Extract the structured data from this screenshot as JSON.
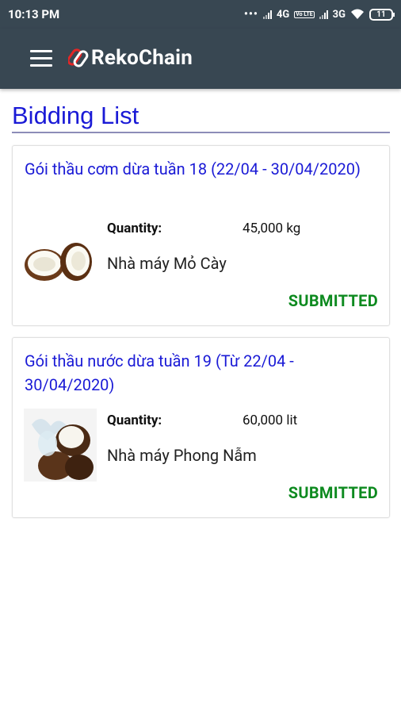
{
  "status_bar": {
    "time": "10:13 PM",
    "net1": "4G",
    "volte": "Vo LTE",
    "net2": "3G",
    "battery": "11"
  },
  "app_bar": {
    "menu_icon": "hamburger-menu-icon",
    "logo_text": "RekoChain"
  },
  "page": {
    "title": "Bidding List"
  },
  "colors": {
    "bar": "#384752",
    "title": "#1a1ad6",
    "status": "#0d8a1f"
  },
  "bids": [
    {
      "title": "Gói thầu cơm dừa tuần 18 (22/04 - 30/04/2020)",
      "quantity_label": "Quantity:",
      "quantity": "45,000 kg",
      "factory": "Nhà máy Mỏ Cày",
      "status": "SUBMITTED",
      "image": "coconut-halves-image"
    },
    {
      "title": "Gói thầu nước dừa tuần 19 (Từ 22/04 - 30/04/2020)",
      "quantity_label": "Quantity:",
      "quantity": "60,000 lit",
      "factory": "Nhà máy Phong Nẫm",
      "status": "SUBMITTED",
      "image": "coconut-water-splash-image"
    }
  ]
}
